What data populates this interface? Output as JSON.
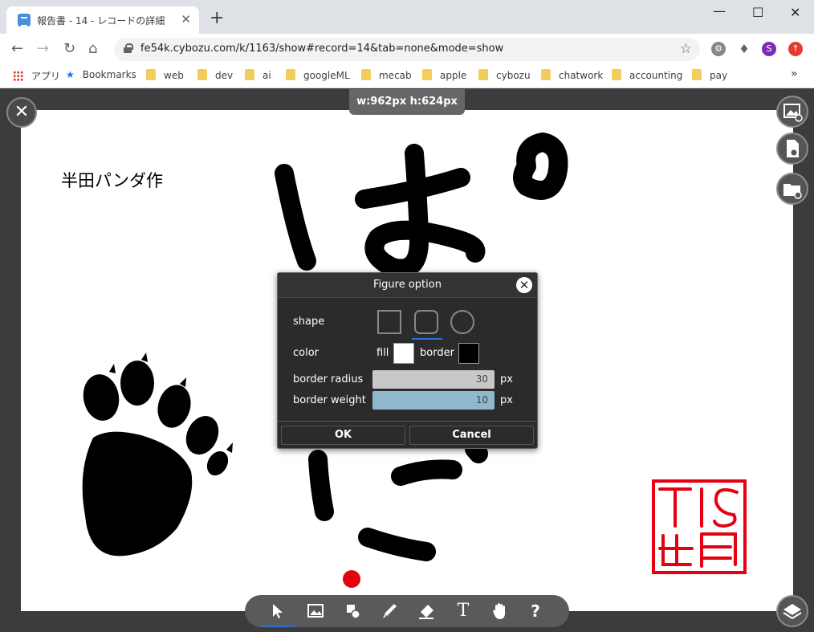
{
  "browser": {
    "tab_title": "報告書 - 14 - レコードの詳細",
    "tab_close": "✕",
    "new_tab": "+",
    "url": "fe54k.cybozu.com/k/1163/show#record=14&tab=none&mode=show",
    "profile_initial": "S",
    "bookmarks": [
      "アプリ",
      "Bookmarks",
      "web",
      "dev",
      "ai",
      "googleML",
      "mecab",
      "apple",
      "cybozu",
      "chatwork",
      "accounting",
      "pay"
    ],
    "bookmarks_more": "»"
  },
  "editor": {
    "size_label": "w:962px  h:624px",
    "author_text": "半田パンダ作",
    "stamp_text": "TIS",
    "accent_color": "#2e6fd8",
    "dot_color": "#e60012",
    "tools": [
      "select-tool",
      "image-tool",
      "shape-tool",
      "pen-tool",
      "eraser-tool",
      "text-tool",
      "hand-tool",
      "help-tool"
    ],
    "tool_glyphs": {
      "text": "T",
      "help": "?"
    },
    "active_tool": "shape-tool"
  },
  "dialog": {
    "title": "Figure option",
    "shape_label": "shape",
    "shapes": [
      "square",
      "rounded-square",
      "circle"
    ],
    "selected_shape": "rounded-square",
    "color_label": "color",
    "fill_label": "fill",
    "fill_color": "#ffffff",
    "border_label": "border",
    "border_color": "#000000",
    "border_radius_label": "border radius",
    "border_radius_value": "30",
    "border_weight_label": "border weight",
    "border_weight_value": "10",
    "unit": "px",
    "ok_label": "OK",
    "cancel_label": "Cancel"
  }
}
